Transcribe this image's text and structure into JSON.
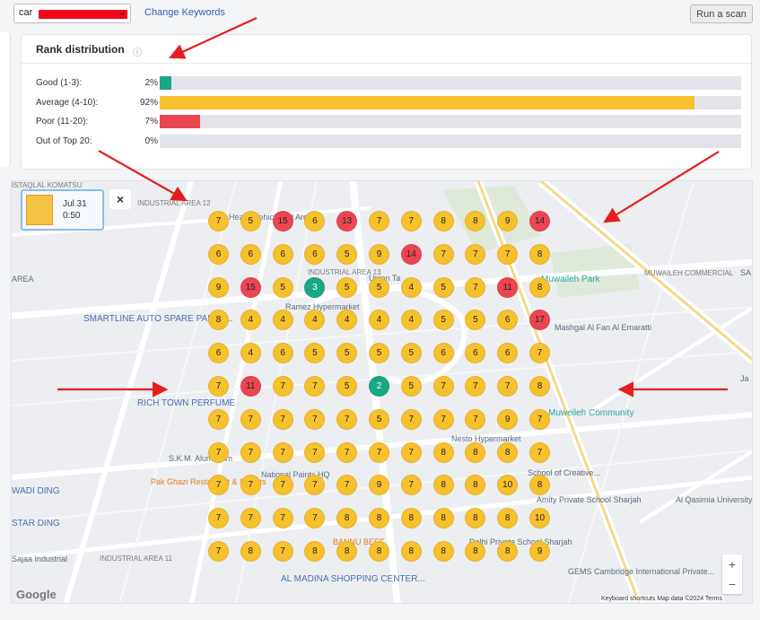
{
  "toolbar": {
    "keyword_value": "car",
    "change_keywords": "Change Keywords",
    "run_scan": "Run a scan"
  },
  "rank_distribution": {
    "title": "Rank distribution",
    "info_icon": "info-icon",
    "rows": [
      {
        "label": "Good (1-3):",
        "pct": "2%",
        "value": 0.02,
        "color": "#19a886"
      },
      {
        "label": "Average (4-10):",
        "pct": "92%",
        "value": 0.92,
        "color": "#f7c12e"
      },
      {
        "label": "Poor (11-20):",
        "pct": "7%",
        "value": 0.07,
        "color": "#ec4552"
      },
      {
        "label": "Out of Top 20:",
        "pct": "0%",
        "value": 0.0,
        "color": "#19a886"
      }
    ]
  },
  "scan_card": {
    "date": "Jul 31",
    "time": "0:50",
    "close": "×"
  },
  "map": {
    "labels": [
      {
        "id": "istaqlal",
        "text": "ISTAQLAL KOMATSU"
      },
      {
        "id": "industrial12",
        "text": "INDUSTRIAL AREA 12"
      },
      {
        "id": "heavy",
        "text": "Heavy Vehicle Ind Area"
      },
      {
        "id": "area",
        "text": "AREA"
      },
      {
        "id": "smartline",
        "text": "SMARTLINE AUTO SPARE PARTS..."
      },
      {
        "id": "industrial13",
        "text": "INDUSTRIAL AREA 13"
      },
      {
        "id": "union",
        "text": "Union Ta"
      },
      {
        "id": "ramez",
        "text": "Ramez Hypermarket"
      },
      {
        "id": "muwailehPark",
        "text": "Muwaileh Park"
      },
      {
        "id": "muwailehCom",
        "text": "MUWAILEH COMMERCIAL"
      },
      {
        "id": "qashgal",
        "text": "Mashgal Al Fan Al Emaratti"
      },
      {
        "id": "richtown",
        "text": "RICH TOWN PERFUME"
      },
      {
        "id": "muwailehCommunity",
        "text": "Muweileh Community"
      },
      {
        "id": "skm",
        "text": "S.K.M. Aluminium"
      },
      {
        "id": "nesto",
        "text": "Nesto Hypermarket"
      },
      {
        "id": "pakghazi",
        "text": "Pak Ghazi Restaurant & Sweets"
      },
      {
        "id": "national",
        "text": "National Paints HQ"
      },
      {
        "id": "school",
        "text": "School of Creative..."
      },
      {
        "id": "amity",
        "text": "Amity Private School Sharjah"
      },
      {
        "id": "alqasimia",
        "text": "Al Qasimia University"
      },
      {
        "id": "wadi",
        "text": "WADI DING"
      },
      {
        "id": "star",
        "text": "STAR DING"
      },
      {
        "id": "sajaa",
        "text": "Sajaa Industrial"
      },
      {
        "id": "industrial11",
        "text": "INDUSTRIAL AREA 11"
      },
      {
        "id": "bannu",
        "text": "BANNU BEEF"
      },
      {
        "id": "delhi",
        "text": "Delhi Private School Sharjah"
      },
      {
        "id": "gems",
        "text": "GEMS Cambridge International Private..."
      },
      {
        "id": "almadina",
        "text": "AL MADINA SHOPPING CENTER..."
      },
      {
        "id": "sa",
        "text": "SA"
      },
      {
        "id": "ja",
        "text": "Ja"
      }
    ],
    "grid": [
      [
        7,
        5,
        15,
        6,
        13,
        7,
        7,
        8,
        8,
        9,
        14
      ],
      [
        6,
        6,
        6,
        6,
        5,
        9,
        14,
        7,
        7,
        7,
        8
      ],
      [
        9,
        15,
        5,
        3,
        5,
        5,
        4,
        5,
        7,
        11,
        8
      ],
      [
        8,
        4,
        4,
        4,
        4,
        4,
        4,
        5,
        5,
        6,
        17
      ],
      [
        6,
        4,
        6,
        5,
        5,
        5,
        5,
        6,
        6,
        6,
        7
      ],
      [
        7,
        11,
        7,
        7,
        5,
        2,
        5,
        7,
        7,
        7,
        8
      ],
      [
        7,
        7,
        7,
        7,
        7,
        5,
        7,
        7,
        7,
        9,
        7
      ],
      [
        7,
        7,
        7,
        7,
        7,
        7,
        7,
        8,
        8,
        8,
        7
      ],
      [
        7,
        7,
        7,
        7,
        7,
        9,
        7,
        8,
        8,
        10,
        8
      ],
      [
        7,
        7,
        7,
        7,
        8,
        8,
        8,
        8,
        8,
        8,
        10
      ],
      [
        7,
        8,
        7,
        8,
        8,
        8,
        8,
        8,
        8,
        8,
        9
      ]
    ],
    "zoom_in": "+",
    "zoom_out": "−",
    "logo": "Google",
    "attribution": "Keyboard shortcuts   Map data ©2024   Terms"
  }
}
